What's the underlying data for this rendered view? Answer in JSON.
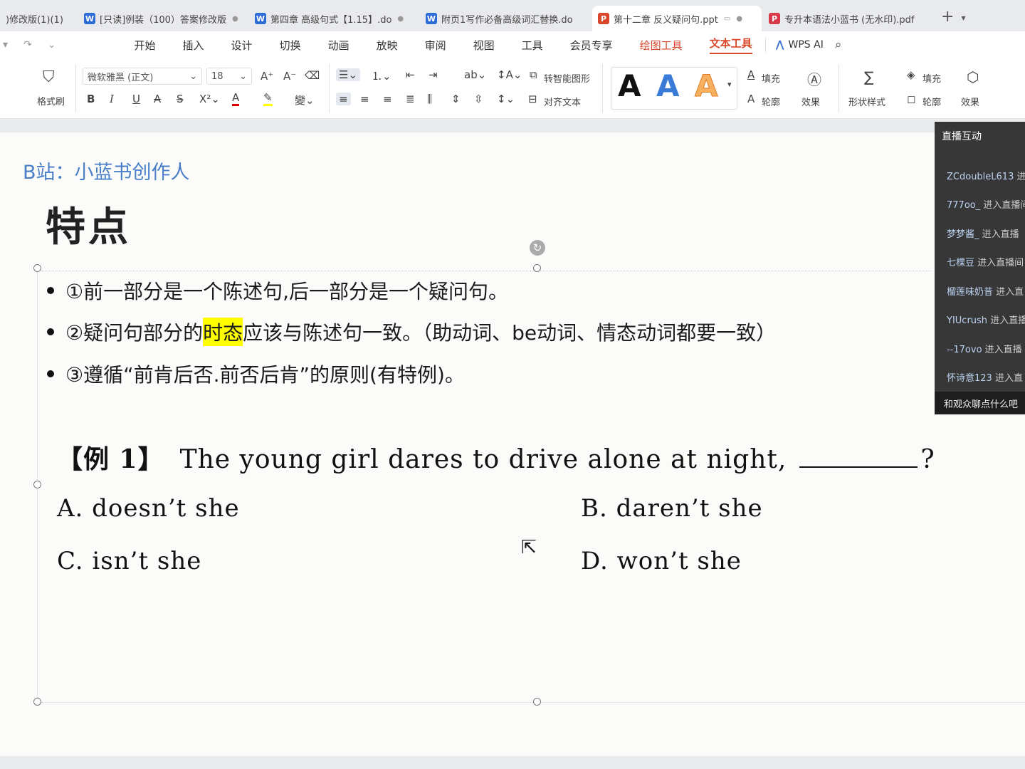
{
  "tabs": [
    {
      "label": ")修改版(1)(1)",
      "icon": "",
      "type": "none"
    },
    {
      "label": "[只读]例装（100）答案修改版",
      "icon": "W",
      "type": "w"
    },
    {
      "label": "第四章 高级句式【1.15】.do",
      "icon": "W",
      "type": "w"
    },
    {
      "label": "附页1写作必备高级词汇替换.do",
      "icon": "W",
      "type": "w"
    },
    {
      "label": "第十二章 反义疑问句.ppt",
      "icon": "P",
      "type": "p"
    },
    {
      "label": "专升本语法小蓝书 (无水印).pdf",
      "icon": "P",
      "type": "pdf"
    }
  ],
  "menu": {
    "items": [
      "开始",
      "插入",
      "设计",
      "切换",
      "动画",
      "放映",
      "审阅",
      "视图",
      "工具",
      "会员专享"
    ],
    "tool_items": [
      "绘图工具",
      "文本工具"
    ],
    "wps_ai": "WPS AI"
  },
  "ribbon": {
    "format_painter": "格式刷",
    "font_name": "微软雅黑 (正文)",
    "font_size": "18",
    "convert_smart": "转智能图形",
    "align_text": "对齐文本",
    "fill": "填充",
    "outline": "轮廓",
    "effect": "效果",
    "shape_style": "形状样式",
    "fill2": "填充",
    "outline2": "轮廓",
    "effect2": "效果"
  },
  "slide": {
    "watermark": "B站：小蓝书创作人",
    "title": "特点",
    "bullet1": "①前一部分是一个陈述句,后一部分是一个疑问句。",
    "bullet2_pre": "②疑问句部分的",
    "bullet2_hl": "时态",
    "bullet2_post": "应该与陈述句一致。（助动词、be动词、情态动词都要一致）",
    "bullet3": "③遵循“前肯后否.前否后肯”的原则(有特例)。",
    "example_label": "【例 1】",
    "example_text": "The young girl dares to drive alone at night,",
    "example_end": "?",
    "optA": "A. doesn’t she",
    "optB": "B. daren’t she",
    "optC": "C. isn’t she",
    "optD": "D. won’t she"
  },
  "live": {
    "title": "直播互动",
    "messages": [
      {
        "name": "ZCdoubleL613",
        "text": "进"
      },
      {
        "name": "777oo_",
        "text": "进入直播间"
      },
      {
        "name": "梦梦酱_",
        "text": "进入直播"
      },
      {
        "name": "七棵豆",
        "text": "进入直播间"
      },
      {
        "name": "榴莲味奶昔",
        "text": "进入直"
      },
      {
        "name": "YIUcrush",
        "text": "进入直播"
      },
      {
        "name": "--17ovo",
        "text": "进入直播"
      },
      {
        "name": "怀诗意123",
        "text": "进入直"
      }
    ],
    "footer": "和观众聊点什么吧"
  },
  "colors": {
    "accent": "#d9472b",
    "watermark": "#4a7fc8",
    "highlight": "#ffff00"
  }
}
